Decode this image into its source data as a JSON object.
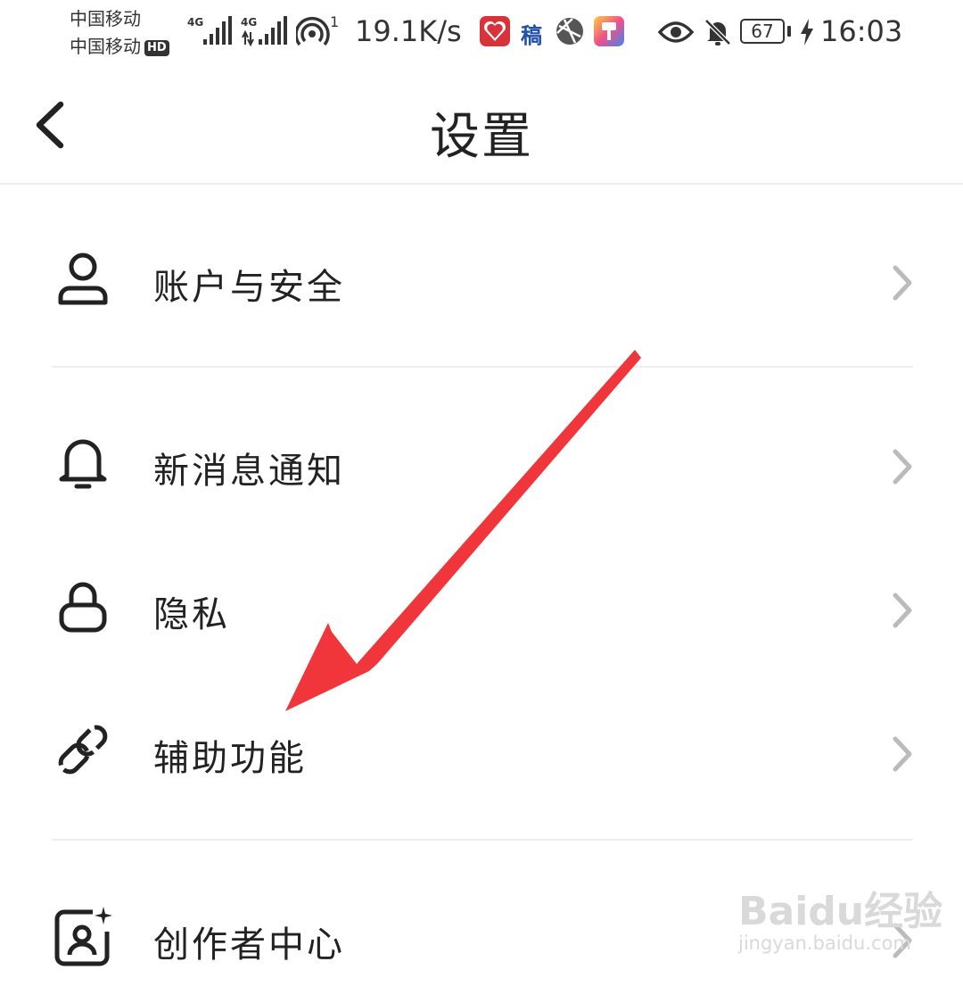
{
  "status_bar": {
    "carrier_1": "中国移动",
    "carrier_2": "中国移动",
    "hd_badge": "HD",
    "signal_1_type": "4G",
    "signal_2_type": "4G",
    "hotspot_count": "1",
    "net_speed": "19.1K/s",
    "app_icon_text": "稿",
    "battery": "67",
    "time": "16:03"
  },
  "header": {
    "title": "设置"
  },
  "settings": {
    "items": [
      {
        "label": "账户与安全",
        "icon": "user-icon"
      },
      {
        "label": "新消息通知",
        "icon": "bell-icon"
      },
      {
        "label": "隐私",
        "icon": "lock-icon"
      },
      {
        "label": "辅助功能",
        "icon": "link-icon"
      },
      {
        "label": "创作者中心",
        "icon": "creator-icon"
      }
    ]
  },
  "annotation": {
    "arrow_color": "#f0363a"
  },
  "watermark": {
    "brand": "Baidu经验",
    "url": "jingyan.baidu.com"
  }
}
